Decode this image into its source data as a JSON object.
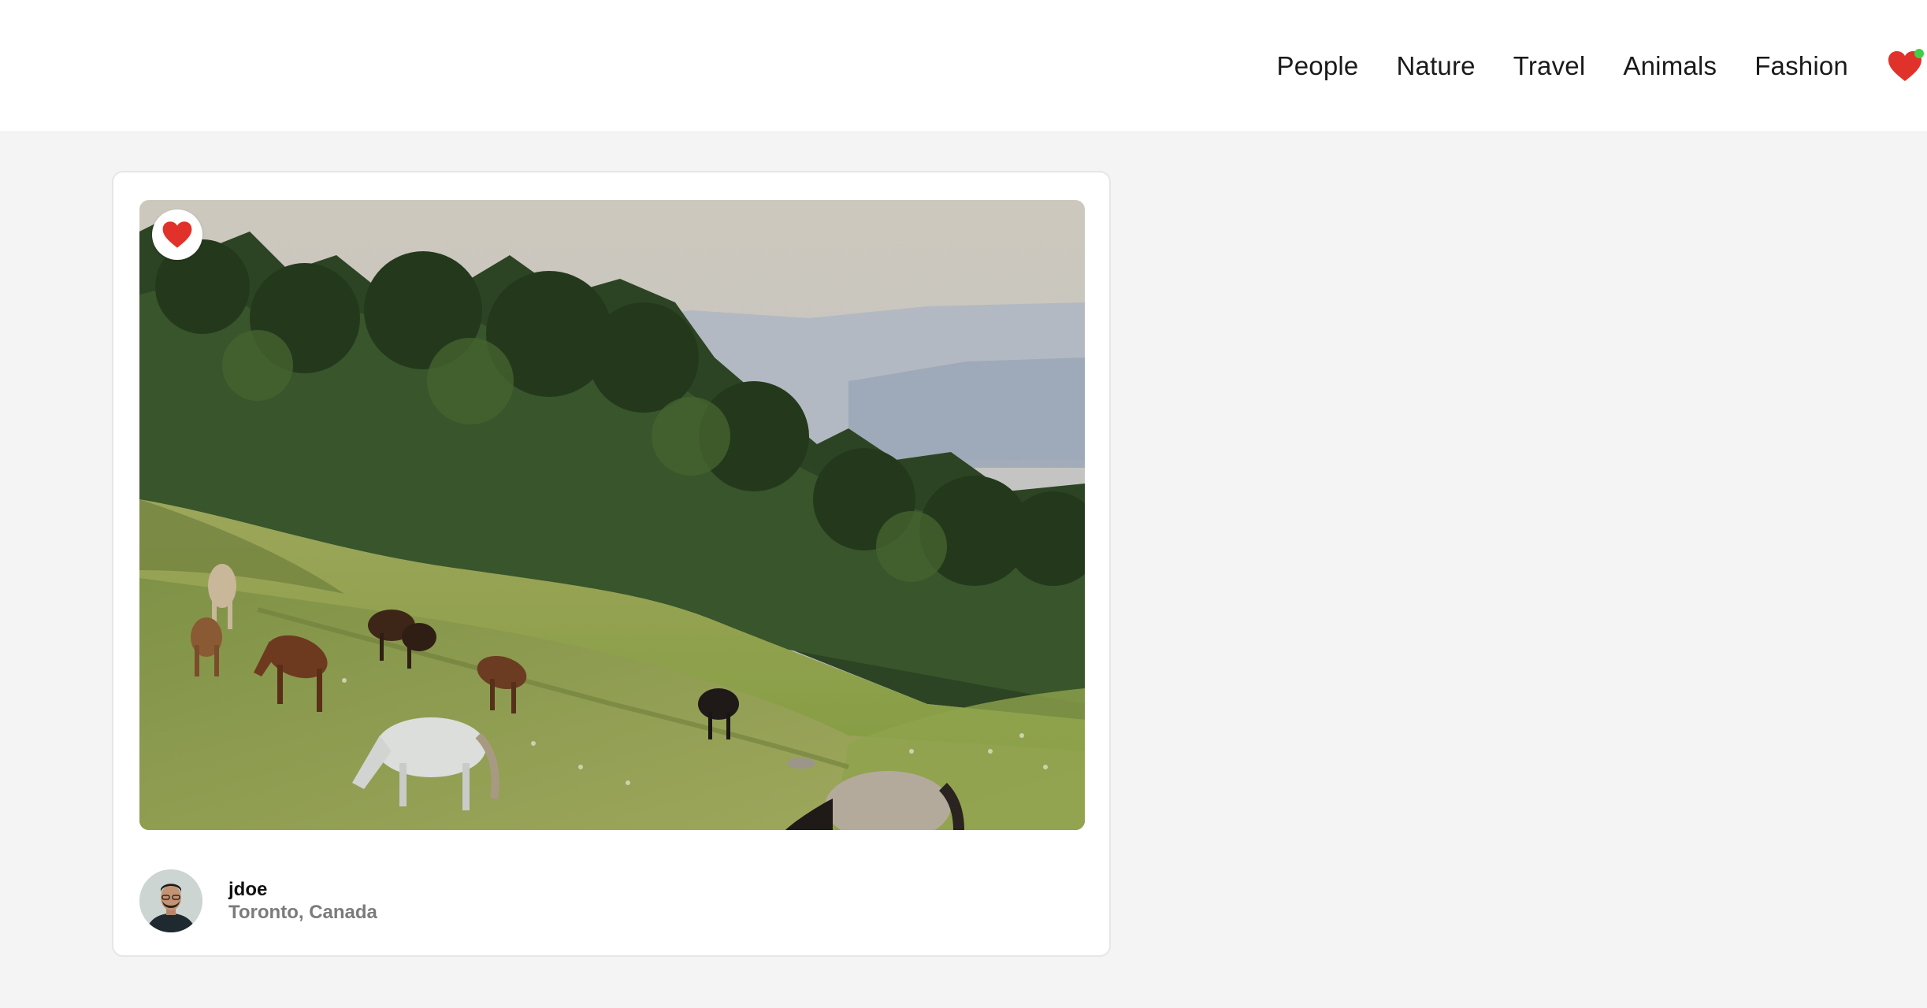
{
  "nav": {
    "links": [
      "People",
      "Nature",
      "Travel",
      "Animals",
      "Fashion"
    ],
    "favorites_icon": "heart-icon",
    "notification_color": "#3fcf45"
  },
  "post": {
    "image_subject": "horses-grazing-hillside",
    "liked": true,
    "like_icon": "heart-icon",
    "like_color": "#e0322b",
    "author": {
      "username": "jdoe",
      "location": "Toronto, Canada"
    }
  }
}
